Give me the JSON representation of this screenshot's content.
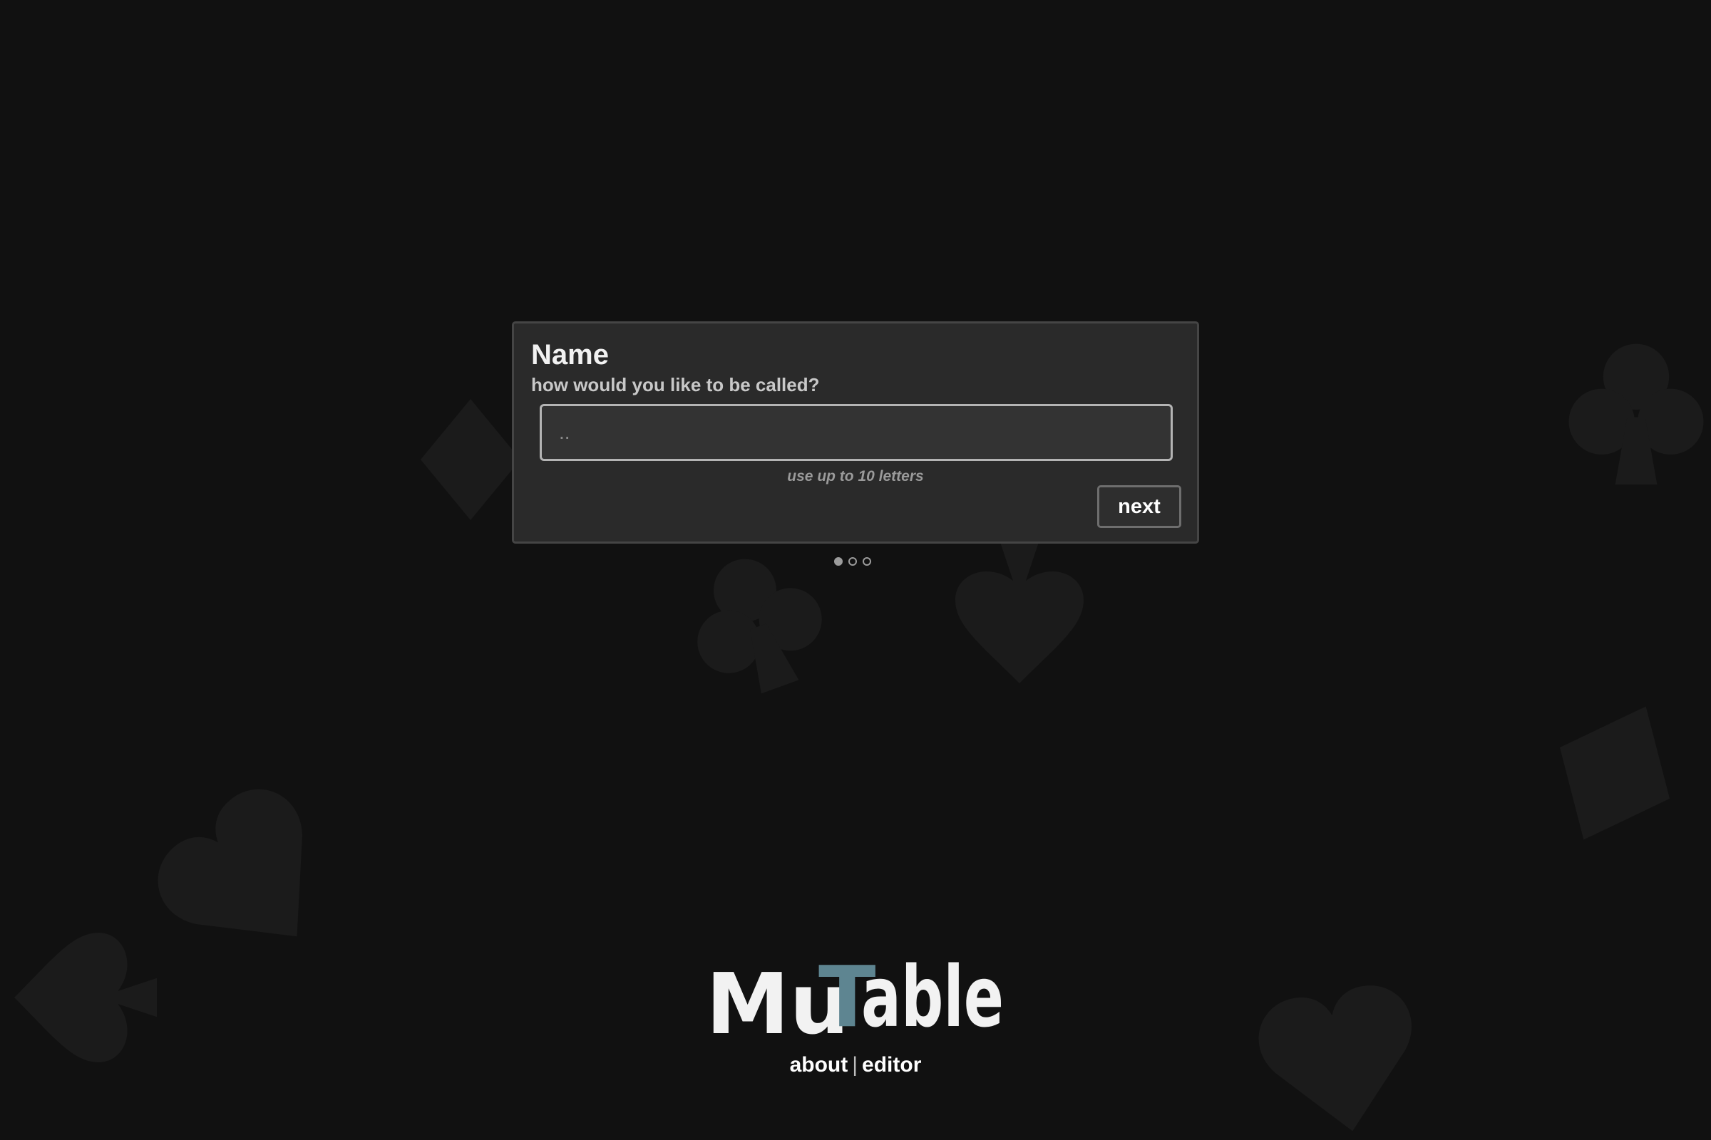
{
  "dialog": {
    "title": "Name",
    "subtitle": "how would you like to be called?",
    "input_value": "",
    "input_placeholder": "..",
    "hint": "use up to 10 letters",
    "next_label": "next"
  },
  "steps": {
    "current": 1,
    "total": 3
  },
  "logo": {
    "part1": "Mu",
    "part2": "T",
    "part3": "able",
    "accent_color": "#5e8591",
    "text_color": "#f2f2f2"
  },
  "footer": {
    "about_label": "about",
    "separator": "|",
    "editor_label": "editor"
  },
  "background": {
    "color": "#111111",
    "suit_icons": [
      "club-icon",
      "diamond-icon",
      "spade-icon",
      "heart-icon"
    ]
  }
}
